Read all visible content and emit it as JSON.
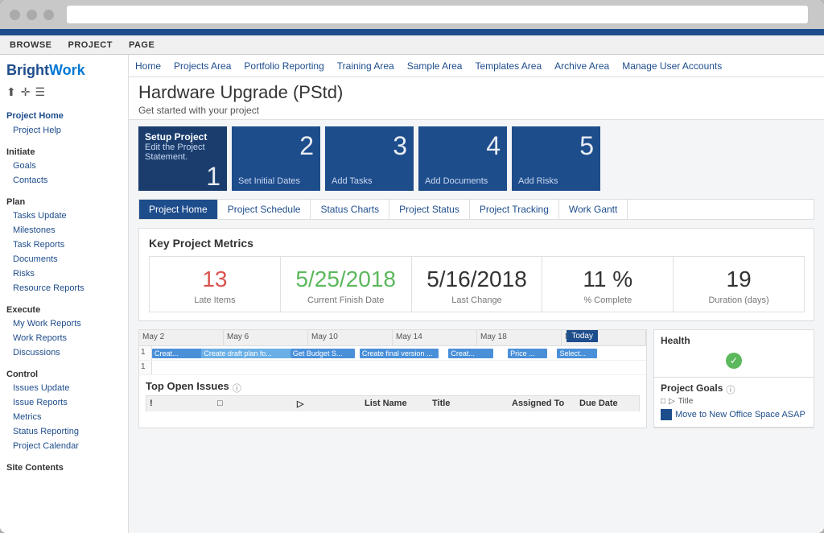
{
  "window": {
    "title": "BrightWork - Hardware Upgrade (PStd)"
  },
  "ribbon": {
    "tabs": [
      "BROWSE",
      "PROJECT",
      "PAGE"
    ]
  },
  "nav": {
    "items": [
      "Home",
      "Projects Area",
      "Portfolio Reporting",
      "Training Area",
      "Sample Area",
      "Templates Area",
      "Archive Area",
      "Manage User Accounts"
    ]
  },
  "sidebar": {
    "logo": "BrightWork",
    "sections": [
      {
        "title": "",
        "items": [
          {
            "label": "Project Home",
            "indent": false
          },
          {
            "label": "Project Help",
            "indent": true
          }
        ]
      },
      {
        "title": "Initiate",
        "items": [
          {
            "label": "Goals",
            "indent": true
          },
          {
            "label": "Contacts",
            "indent": true
          }
        ]
      },
      {
        "title": "Plan",
        "items": [
          {
            "label": "Tasks Update",
            "indent": true
          },
          {
            "label": "Milestones",
            "indent": true
          },
          {
            "label": "Task Reports",
            "indent": true
          },
          {
            "label": "Documents",
            "indent": true
          },
          {
            "label": "Risks",
            "indent": true
          },
          {
            "label": "Resource Reports",
            "indent": true
          }
        ]
      },
      {
        "title": "Execute",
        "items": [
          {
            "label": "My Work Reports",
            "indent": true
          },
          {
            "label": "Work Reports",
            "indent": true
          },
          {
            "label": "Discussions",
            "indent": true
          }
        ]
      },
      {
        "title": "Control",
        "items": [
          {
            "label": "Issues Update",
            "indent": true
          },
          {
            "label": "Issue Reports",
            "indent": true
          },
          {
            "label": "Metrics",
            "indent": true
          },
          {
            "label": "Status Reporting",
            "indent": true
          },
          {
            "label": "Project Calendar",
            "indent": true
          }
        ]
      },
      {
        "title": "Site Contents",
        "items": []
      }
    ]
  },
  "page": {
    "title": "Hardware Upgrade (PStd)",
    "subtitle": "Get started with your project"
  },
  "tiles": [
    {
      "number": "1",
      "label": "Setup Project",
      "sublabel": "Edit the Project Statement."
    },
    {
      "number": "2",
      "label": "Set Initial Dates",
      "sublabel": ""
    },
    {
      "number": "3",
      "label": "Add Tasks",
      "sublabel": ""
    },
    {
      "number": "4",
      "label": "Add Documents",
      "sublabel": ""
    },
    {
      "number": "5",
      "label": "Add Risks",
      "sublabel": ""
    }
  ],
  "section_tabs": [
    "Project Home",
    "Project Schedule",
    "Status Charts",
    "Project Status",
    "Project Tracking",
    "Work Gantt"
  ],
  "metrics": {
    "title": "Key Project Metrics",
    "cards": [
      {
        "value": "13",
        "label": "Late Items",
        "color": "red"
      },
      {
        "value": "5/25/2018",
        "label": "Current Finish Date",
        "color": "green"
      },
      {
        "value": "5/16/2018",
        "label": "Last Change",
        "color": "normal"
      },
      {
        "value": "11 %",
        "label": "% Complete",
        "color": "normal"
      },
      {
        "value": "19",
        "label": "Duration (days)",
        "color": "normal"
      }
    ]
  },
  "gantt": {
    "today_label": "Today",
    "dates": [
      "May 2",
      "May 6",
      "May 10",
      "May 14",
      "May 18",
      "May 22"
    ],
    "rows": [
      {
        "id": "1",
        "bars": [
          {
            "text": "Creat...",
            "date": "5/2 - 5/",
            "left": "0%",
            "width": "15%",
            "color": "#4a90d9"
          },
          {
            "text": "Create draft plan fo...",
            "date": "5/4 - 5/7",
            "left": "8%",
            "width": "22%",
            "color": "#4a90d9"
          },
          {
            "text": "Get Budget S...",
            "date": "5/8 - 5/10",
            "left": "30%",
            "width": "15%",
            "color": "#4a90d9"
          },
          {
            "text": "Create final version ...",
            "date": "5/11 - 5/14",
            "left": "45%",
            "width": "18%",
            "color": "#4a90d9"
          },
          {
            "text": "Creat...",
            "date": "5/17 - 5",
            "left": "63%",
            "width": "10%",
            "color": "#4a90d9"
          },
          {
            "text": "Price ...",
            "date": "5/21 - 5",
            "left": "76%",
            "width": "9%",
            "color": "#4a90d9"
          },
          {
            "text": "Select...",
            "date": "5/23 - 5",
            "left": "86%",
            "width": "9%",
            "color": "#4a90d9"
          }
        ]
      },
      {
        "id": "1",
        "bars": []
      }
    ]
  },
  "right_panel": {
    "health_title": "Health",
    "health_status": "✓",
    "goals_title": "Project Goals",
    "goals_info": "ⓘ",
    "goals_columns": [
      "□",
      "▷",
      "Title"
    ],
    "goals_items": [
      {
        "label": "Move to New Office Space ASAP"
      }
    ]
  },
  "issues": {
    "title": "Top Open Issues",
    "info": "ⓘ",
    "columns": [
      "!",
      "□",
      "▷",
      "List Name",
      "Title",
      "Assigned To",
      "Due Date"
    ]
  },
  "colors": {
    "brand_blue": "#1e4d8c",
    "link_blue": "#0078d4",
    "red": "#d9534f",
    "green": "#5cb85c",
    "gantt_bar": "#4a90d9"
  }
}
